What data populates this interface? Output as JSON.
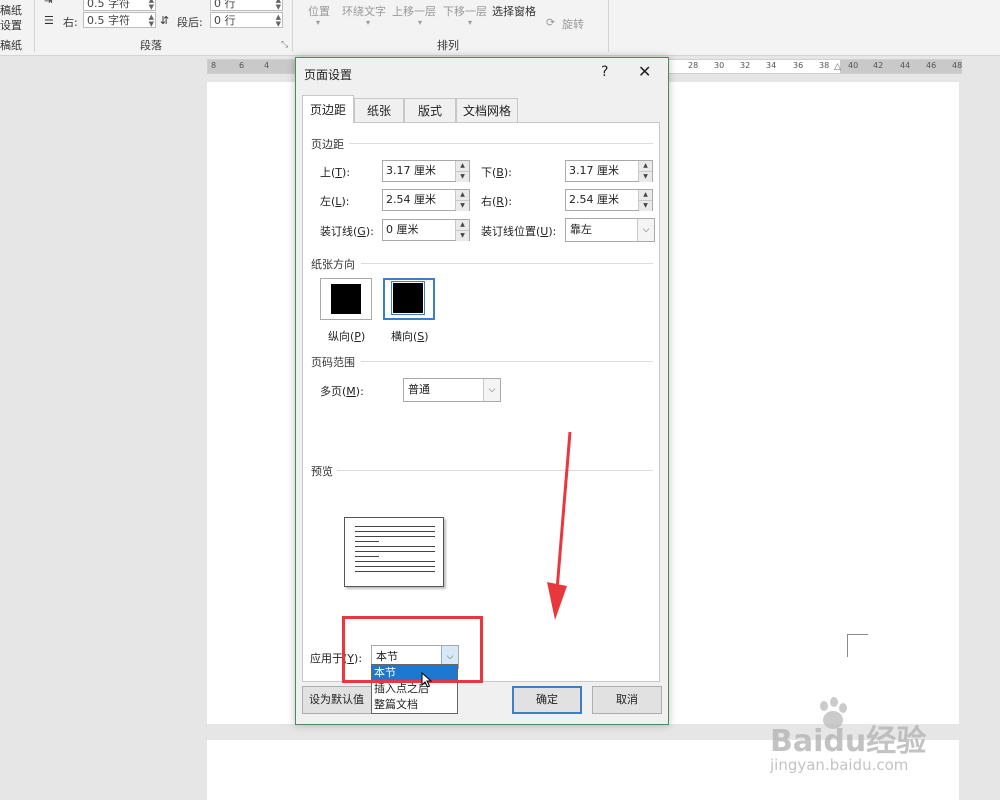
{
  "ribbon": {
    "left_labels": [
      "稿纸",
      "设置",
      "稿纸"
    ],
    "indent_left_value": "0.5 字符",
    "indent_right_label": "右:",
    "indent_right_value": "0.5 字符",
    "space_before_value": "0 行",
    "space_after_label": "段后:",
    "space_after_value": "0 行",
    "group_paragraph": "段落",
    "arrange_items": [
      "位置",
      "环绕文字",
      "上移一层",
      "下移一层"
    ],
    "selection_pane": "选择窗格",
    "rotate": "旋转",
    "group_arrange": "排列"
  },
  "ruler": {
    "numbers_left": [
      "8",
      "6",
      "4"
    ],
    "numbers_right": [
      "28",
      "30",
      "32",
      "34",
      "36",
      "38",
      "40",
      "42",
      "44",
      "46",
      "48"
    ]
  },
  "dialog": {
    "title": "页面设置",
    "help": "?",
    "close": "✕",
    "tabs": [
      {
        "label": "页边距",
        "active": true
      },
      {
        "label": "纸张",
        "active": false
      },
      {
        "label": "版式",
        "active": false
      },
      {
        "label": "文档网格",
        "active": false
      }
    ],
    "margins": {
      "section_title": "页边距",
      "top_label": "上",
      "top_key": "T",
      "top_value": "3.17 厘米",
      "bottom_label": "下",
      "bottom_key": "B",
      "bottom_value": "3.17 厘米",
      "left_label": "左",
      "left_key": "L",
      "left_value": "2.54 厘米",
      "right_label": "右",
      "right_key": "R",
      "right_value": "2.54 厘米",
      "gutter_label": "装订线",
      "gutter_key": "G",
      "gutter_value": "0 厘米",
      "gutter_pos_label": "装订线位置",
      "gutter_pos_key": "U",
      "gutter_pos_value": "靠左"
    },
    "orientation": {
      "section_title": "纸张方向",
      "portrait_label": "纵向",
      "portrait_key": "P",
      "landscape_label": "横向",
      "landscape_key": "S",
      "selected": "landscape"
    },
    "pages": {
      "section_title": "页码范围",
      "multiple_label": "多页",
      "multiple_key": "M",
      "multiple_value": "普通"
    },
    "preview": {
      "section_title": "预览"
    },
    "apply": {
      "label": "应用于",
      "key": "Y",
      "value": "本节",
      "options": [
        "本节",
        "插入点之后",
        "整篇文档"
      ],
      "highlighted": "本节"
    },
    "buttons": {
      "set_default": "设为默认值",
      "ok": "确定",
      "cancel": "取消"
    }
  },
  "watermark": {
    "brand": "Baidu经验",
    "url": "jingyan.baidu.com"
  },
  "colors": {
    "annotation_red": "#e8383d",
    "highlight_blue": "#1e78d0",
    "dialog_border": "#4b8a5a"
  }
}
